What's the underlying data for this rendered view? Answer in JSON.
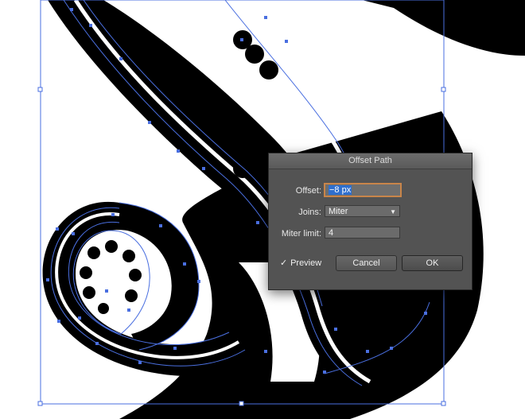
{
  "dialog": {
    "title": "Offset Path",
    "offset": {
      "label": "Offset:",
      "value": "−8 px"
    },
    "joins": {
      "label": "Joins:",
      "value": "Miter"
    },
    "miter_limit": {
      "label": "Miter limit:",
      "value": "4"
    },
    "preview": {
      "label": "Preview",
      "checked": true,
      "mark": "✓"
    },
    "cancel_label": "Cancel",
    "ok_label": "OK"
  },
  "colors": {
    "artwork": "#000000",
    "selection": "#4a6fe0",
    "dialog_bg": "#535353",
    "focus_ring": "#c8854a"
  },
  "icons": {
    "joins_dropdown": "chevron-down-icon",
    "preview_check": "checkmark-icon"
  }
}
